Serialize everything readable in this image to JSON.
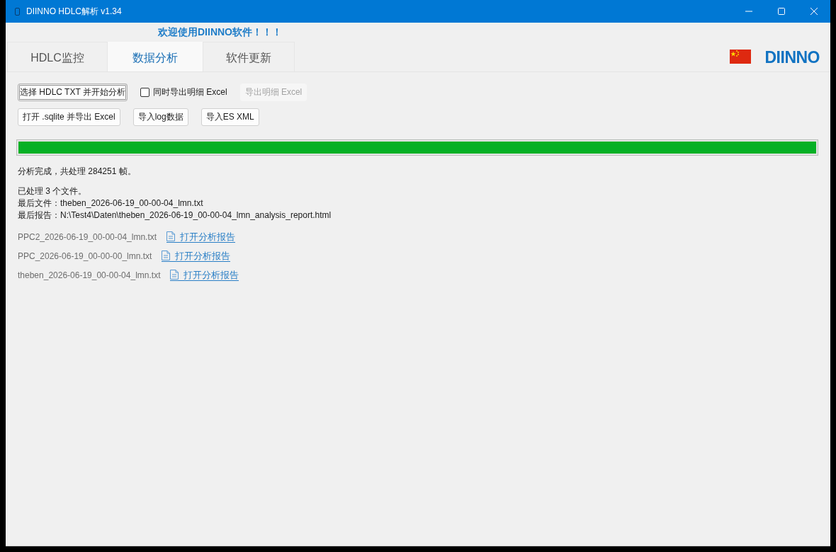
{
  "window": {
    "title": "DIINNO HDLC解析 v1.34"
  },
  "header": {
    "welcome": "欢迎使用DIINNO软件！！！",
    "logo": "DIINNO"
  },
  "tabs": [
    {
      "label": "HDLC监控",
      "selected": false
    },
    {
      "label": "数据分析",
      "selected": true
    },
    {
      "label": "软件更新",
      "selected": false
    }
  ],
  "toolbar_rows": [
    [
      {
        "kind": "button",
        "label": "选择 HDLC TXT 并开始分析",
        "focused": true,
        "disabled": false
      },
      {
        "kind": "checkbox",
        "label": "同时导出明细 Excel",
        "checked": false
      },
      {
        "kind": "button",
        "label": "导出明细 Excel",
        "focused": false,
        "disabled": true
      }
    ],
    [
      {
        "kind": "button",
        "label": "打开 .sqlite 并导出 Excel",
        "focused": false,
        "disabled": false
      },
      {
        "kind": "button",
        "label": "导入log数据",
        "focused": false,
        "disabled": false
      },
      {
        "kind": "button",
        "label": "导入ES XML",
        "focused": false,
        "disabled": false
      }
    ]
  ],
  "progress": {
    "level": 1
  },
  "status": "分析完成，共处理 284251 帧。",
  "summary": [
    "已处理 3 个文件。",
    "最后文件：theben_2026-06-19_00-00-04_lmn.txt",
    "最后报告：N:\\Test4\\Daten\\theben_2026-06-19_00-00-04_lmn_analysis_report.html"
  ],
  "files": [
    {
      "name": "PPC2_2026-06-19_00-00-04_lmn.txt",
      "link": "打开分析报告"
    },
    {
      "name": "PPC_2026-06-19_00-00-00_lmn.txt",
      "link": "打开分析报告"
    },
    {
      "name": "theben_2026-06-19_00-00-04_lmn.txt",
      "link": "打开分析报告"
    }
  ]
}
